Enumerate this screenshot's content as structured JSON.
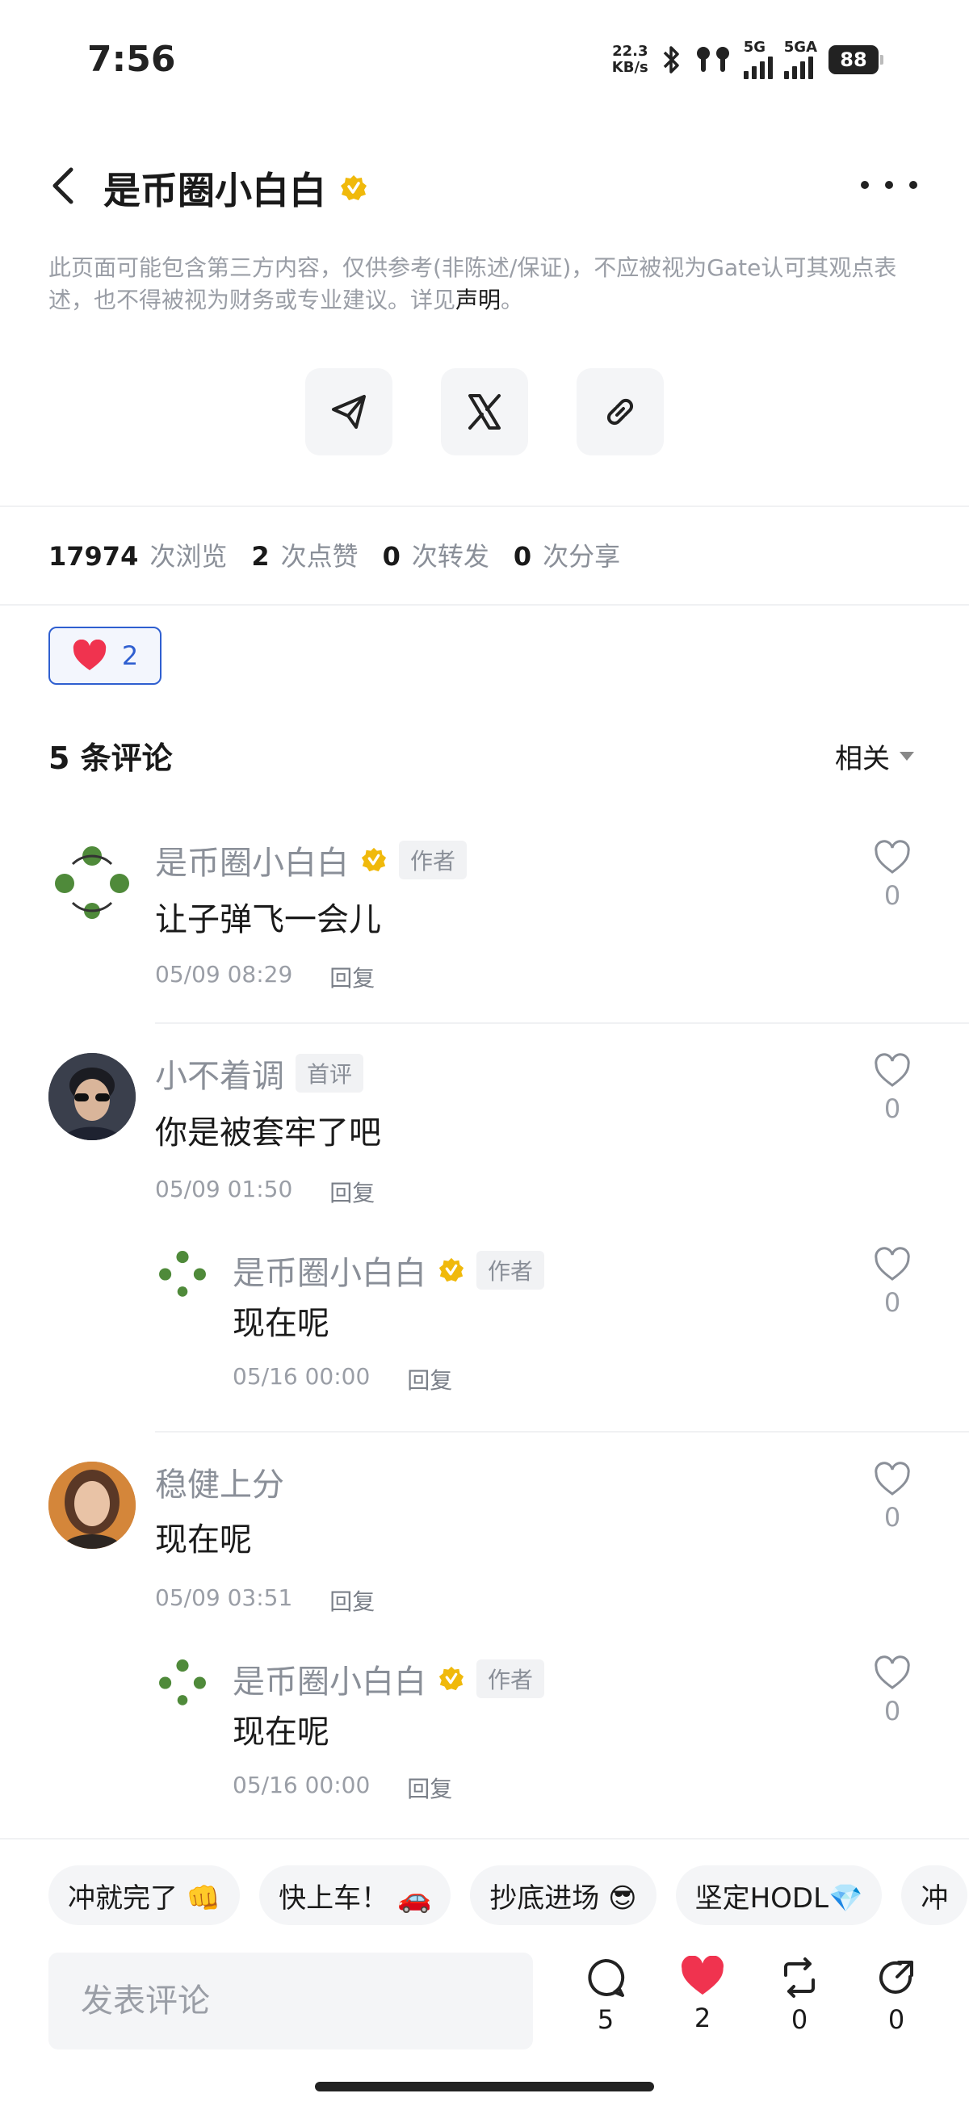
{
  "status_bar": {
    "time": "7:56",
    "net_speed_value": "22.3",
    "net_speed_unit": "KB/s",
    "signal1_label": "5G",
    "signal2_label": "5GA",
    "battery": "88"
  },
  "header": {
    "title": "是币圈小白白"
  },
  "disclaimer": {
    "text": "此页面可能包含第三方内容，仅供参考(非陈述/保证)，不应被视为Gate认可其观点表述，也不得被视为财务或专业建议。详见",
    "link": "声明",
    "end": "。"
  },
  "stats": {
    "views": "17974",
    "views_label": "次浏览",
    "likes": "2",
    "likes_label": "次点赞",
    "reposts": "0",
    "reposts_label": "次转发",
    "shares": "0",
    "shares_label": "次分享"
  },
  "reaction": {
    "count": "2"
  },
  "comments_header": {
    "count_label": "5 条评论",
    "sort_label": "相关"
  },
  "comments": [
    {
      "name": "是币圈小白白",
      "badge": "作者",
      "text": "让子弹飞一会儿",
      "time": "05/09 08:29",
      "reply": "回复",
      "likes": "0"
    },
    {
      "name": "小不着调",
      "badge": "首评",
      "text": "你是被套牢了吧",
      "time": "05/09 01:50",
      "reply": "回复",
      "likes": "0"
    },
    {
      "name": "是币圈小白白",
      "badge": "作者",
      "text": "现在呢",
      "time": "05/16 00:00",
      "reply": "回复",
      "likes": "0"
    },
    {
      "name": "稳健上分",
      "text": "现在呢",
      "time": "05/09 03:51",
      "reply": "回复",
      "likes": "0"
    },
    {
      "name": "是币圈小白白",
      "badge": "作者",
      "text": "现在呢",
      "time": "05/16 00:00",
      "reply": "回复",
      "likes": "0"
    }
  ],
  "quick_replies": [
    "冲就完了 👊",
    "快上车！ 🚗",
    "抄底进场 😎",
    "坚定HODL💎",
    "冲"
  ],
  "bottom_bar": {
    "placeholder": "发表评论",
    "comments": "5",
    "likes": "2",
    "reposts": "0",
    "shares": "0"
  },
  "colors": {
    "accent": "#2f5fd0",
    "heart": "#f0334f",
    "verified": "#f0b90b"
  }
}
